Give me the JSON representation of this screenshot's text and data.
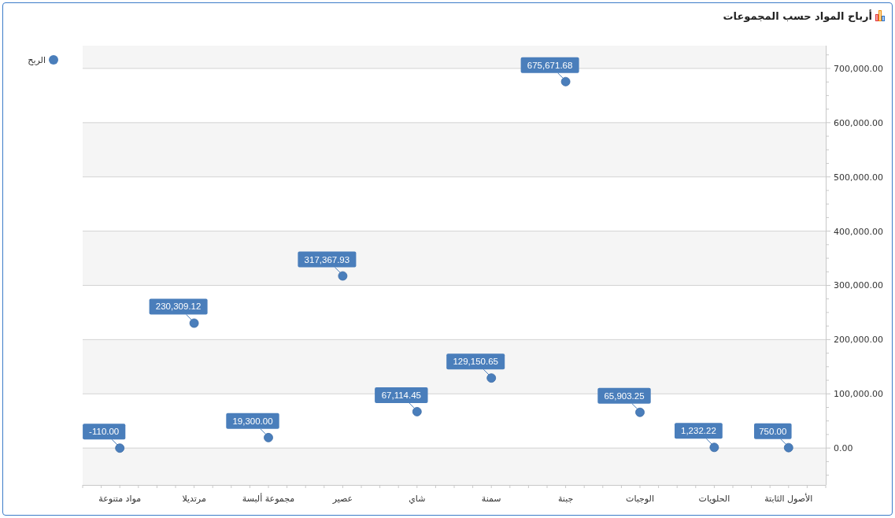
{
  "title": "أرباح المواد حسب المجموعات",
  "chart_data": {
    "type": "scatter",
    "grid": true,
    "categories": [
      "مواد متنوعة",
      "مرتديلا",
      "مجموعة ألبسة",
      "عصير",
      "شاي",
      "سمنة",
      "جبنة",
      "الوجبات",
      "الحلويات",
      "الأصول الثابتة"
    ],
    "series": [
      {
        "name": "الربح",
        "color": "#4a7ebb",
        "values": [
          -110,
          230309.12,
          19300,
          317367.93,
          67114.45,
          129150.65,
          675671.68,
          65903.25,
          1232.22,
          750
        ]
      }
    ],
    "value_labels": [
      "-110.00",
      "230,309.12",
      "19,300.00",
      "317,367.93",
      "67,114.45",
      "129,150.65",
      "675,671.68",
      "65,903.25",
      "1,232.22",
      "750.00"
    ],
    "ylim": [
      -68000,
      742000
    ],
    "yticks": [
      {
        "value": 0,
        "label": "0.00"
      },
      {
        "value": 100000,
        "label": "100,000.00"
      },
      {
        "value": 200000,
        "label": "200,000.00"
      },
      {
        "value": 300000,
        "label": "300,000.00"
      },
      {
        "value": 400000,
        "label": "400,000.00"
      },
      {
        "value": 500000,
        "label": "500,000.00"
      },
      {
        "value": 600000,
        "label": "600,000.00"
      },
      {
        "value": 700000,
        "label": "700,000.00"
      }
    ]
  }
}
